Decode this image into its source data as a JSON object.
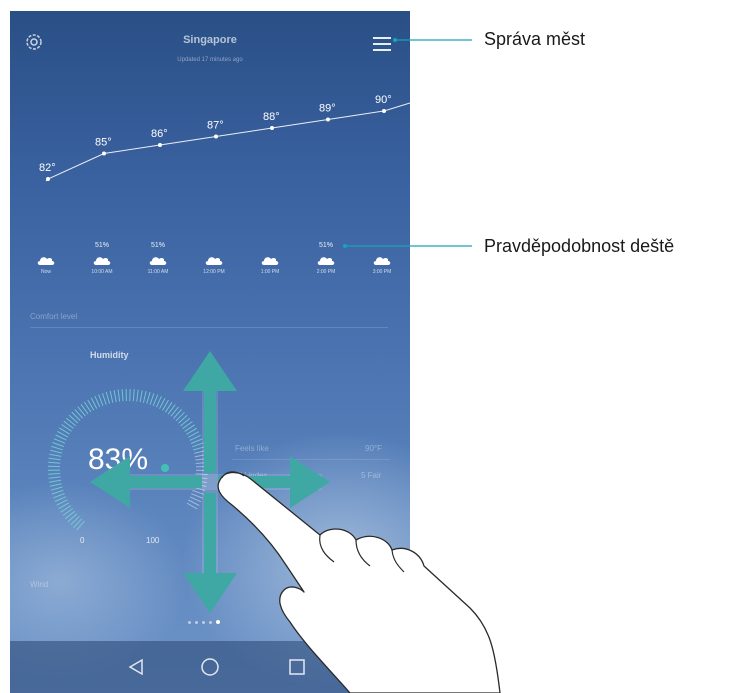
{
  "header": {
    "city": "Singapore",
    "updated": "Updated 17 minutes ago"
  },
  "temperatures": [
    "82°",
    "85°",
    "86°",
    "87°",
    "88°",
    "89°",
    "90°"
  ],
  "hourly": [
    {
      "pct": "",
      "time": "Now"
    },
    {
      "pct": "51%",
      "time": "10:00 AM"
    },
    {
      "pct": "51%",
      "time": "11:00 AM"
    },
    {
      "pct": "",
      "time": "12:00 PM"
    },
    {
      "pct": "",
      "time": "1:00 PM"
    },
    {
      "pct": "51%",
      "time": "2:00 PM"
    },
    {
      "pct": "",
      "time": "3:00 PM"
    }
  ],
  "comfort": {
    "section_label": "Comfort level",
    "humidity_label": "Humidity",
    "humidity_value": "83%",
    "humidity_fraction": 0.83,
    "gauge_min": "0",
    "gauge_max": "100",
    "feels_like_label": "Feels like",
    "feels_like_value": "90°F",
    "uv_label": "UV index",
    "uv_value": "5 Fair"
  },
  "wind_label": "Wind",
  "pager": {
    "count": 5,
    "active": 4
  },
  "callouts": {
    "city_management": "Správa měst",
    "rain_probability": "Pravděpodobnost deště"
  },
  "colors": {
    "accent": "#43c2b4",
    "callout_line": "#1aa3b8",
    "arrow": "#3fa7a4"
  },
  "icons": [
    "gear-icon",
    "menu-icon",
    "cloud-icon",
    "back-icon",
    "home-icon",
    "recents-icon",
    "arrow-up-icon",
    "arrow-down-icon",
    "arrow-left-icon",
    "arrow-right-icon",
    "hand-gesture"
  ]
}
